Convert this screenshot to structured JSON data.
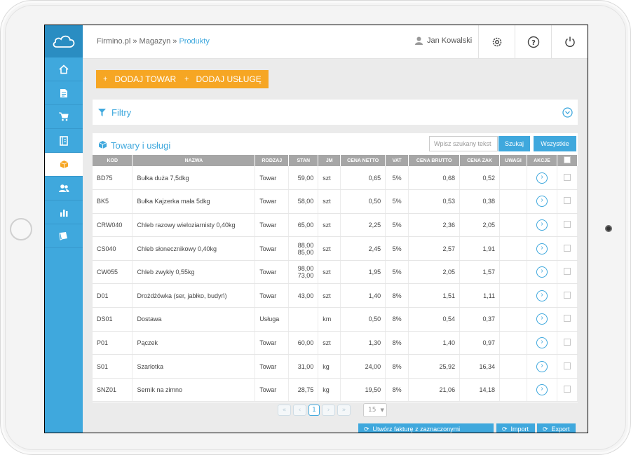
{
  "breadcrumb": {
    "home": "Firmino.pl",
    "sep1": "»",
    "section": "Magazyn",
    "sep2": "»",
    "current": "Produkty"
  },
  "user": {
    "name": "Jan Kowalski"
  },
  "sidebar": {
    "items": [
      {
        "icon": "home-icon"
      },
      {
        "icon": "document-icon"
      },
      {
        "icon": "cart-icon"
      },
      {
        "icon": "book-icon"
      },
      {
        "icon": "box-icon",
        "active": true
      },
      {
        "icon": "users-icon"
      },
      {
        "icon": "chart-icon"
      },
      {
        "icon": "notebook-icon"
      }
    ]
  },
  "toolbar": {
    "add_product": "DODAJ TOWAR",
    "add_service": "DODAJ USŁUGĘ",
    "plus": "+"
  },
  "filters": {
    "title": "Filtry"
  },
  "products": {
    "title": "Towary i usługi",
    "search_placeholder": "Wpisz szukany tekst",
    "search_button": "Szukaj",
    "all_button": "Wszystkie",
    "columns": [
      "KOD",
      "NAZWA",
      "RODZAJ",
      "STAN",
      "JM",
      "CENA NETTO",
      "VAT",
      "CENA BRUTTO",
      "CENA ZAK",
      "UWAGI",
      "AKCJE"
    ],
    "rows": [
      {
        "kod": "BD75",
        "nazwa": "Bułka duża 7,5dkg",
        "rodzaj": "Towar",
        "stan": "59,00",
        "stan2": "",
        "jm": "szt",
        "netto": "0,65",
        "vat": "5%",
        "brutto": "0,68",
        "zak": "0,52",
        "uwagi": ""
      },
      {
        "kod": "BK5",
        "nazwa": "Bułka Kajzerka mała 5dkg",
        "rodzaj": "Towar",
        "stan": "58,00",
        "stan2": "",
        "jm": "szt",
        "netto": "0,50",
        "vat": "5%",
        "brutto": "0,53",
        "zak": "0,38",
        "uwagi": ""
      },
      {
        "kod": "CRW040",
        "nazwa": "Chleb razowy wieloziarnisty 0,40kg",
        "rodzaj": "Towar",
        "stan": "65,00",
        "stan2": "",
        "jm": "szt",
        "netto": "2,25",
        "vat": "5%",
        "brutto": "2,36",
        "zak": "2,05",
        "uwagi": ""
      },
      {
        "kod": "CS040",
        "nazwa": "Chleb słonecznikowy 0,40kg",
        "rodzaj": "Towar",
        "stan": "88,00",
        "stan2": "85,00",
        "jm": "szt",
        "netto": "2,45",
        "vat": "5%",
        "brutto": "2,57",
        "zak": "1,91",
        "uwagi": ""
      },
      {
        "kod": "CW055",
        "nazwa": "Chleb zwykły 0,55kg",
        "rodzaj": "Towar",
        "stan": "98,00",
        "stan2": "73,00",
        "jm": "szt",
        "netto": "1,95",
        "vat": "5%",
        "brutto": "2,05",
        "zak": "1,57",
        "uwagi": ""
      },
      {
        "kod": "D01",
        "nazwa": "Drożdżówka (ser, jabłko, budyń)",
        "rodzaj": "Towar",
        "stan": "43,00",
        "stan2": "",
        "jm": "szt",
        "netto": "1,40",
        "vat": "8%",
        "brutto": "1,51",
        "zak": "1,11",
        "uwagi": ""
      },
      {
        "kod": "DS01",
        "nazwa": "Dostawa",
        "rodzaj": "Usługa",
        "stan": "",
        "stan2": "",
        "jm": "km",
        "netto": "0,50",
        "vat": "8%",
        "brutto": "0,54",
        "zak": "0,37",
        "uwagi": ""
      },
      {
        "kod": "P01",
        "nazwa": "Pączek",
        "rodzaj": "Towar",
        "stan": "60,00",
        "stan2": "",
        "jm": "szt",
        "netto": "1,30",
        "vat": "8%",
        "brutto": "1,40",
        "zak": "0,97",
        "uwagi": ""
      },
      {
        "kod": "S01",
        "nazwa": "Szarlotka",
        "rodzaj": "Towar",
        "stan": "31,00",
        "stan2": "",
        "jm": "kg",
        "netto": "24,00",
        "vat": "8%",
        "brutto": "25,92",
        "zak": "16,34",
        "uwagi": ""
      },
      {
        "kod": "SNZ01",
        "nazwa": "Sernik na zimno",
        "rodzaj": "Towar",
        "stan": "28,75",
        "stan2": "",
        "jm": "kg",
        "netto": "19,50",
        "vat": "8%",
        "brutto": "21,06",
        "zak": "14,18",
        "uwagi": ""
      }
    ]
  },
  "pagination": {
    "first": "«",
    "prev": "‹",
    "current_page": "1",
    "next": "›",
    "last": "»",
    "per_page": "15"
  },
  "bottom_actions": {
    "invoice": "Utwórz fakturę z zaznaczonymi pozycjami",
    "import": "Import",
    "export": "Export"
  },
  "colors": {
    "accent": "#3fa8dd",
    "orange": "#f6a623",
    "header_gray": "#a6a6a6"
  }
}
